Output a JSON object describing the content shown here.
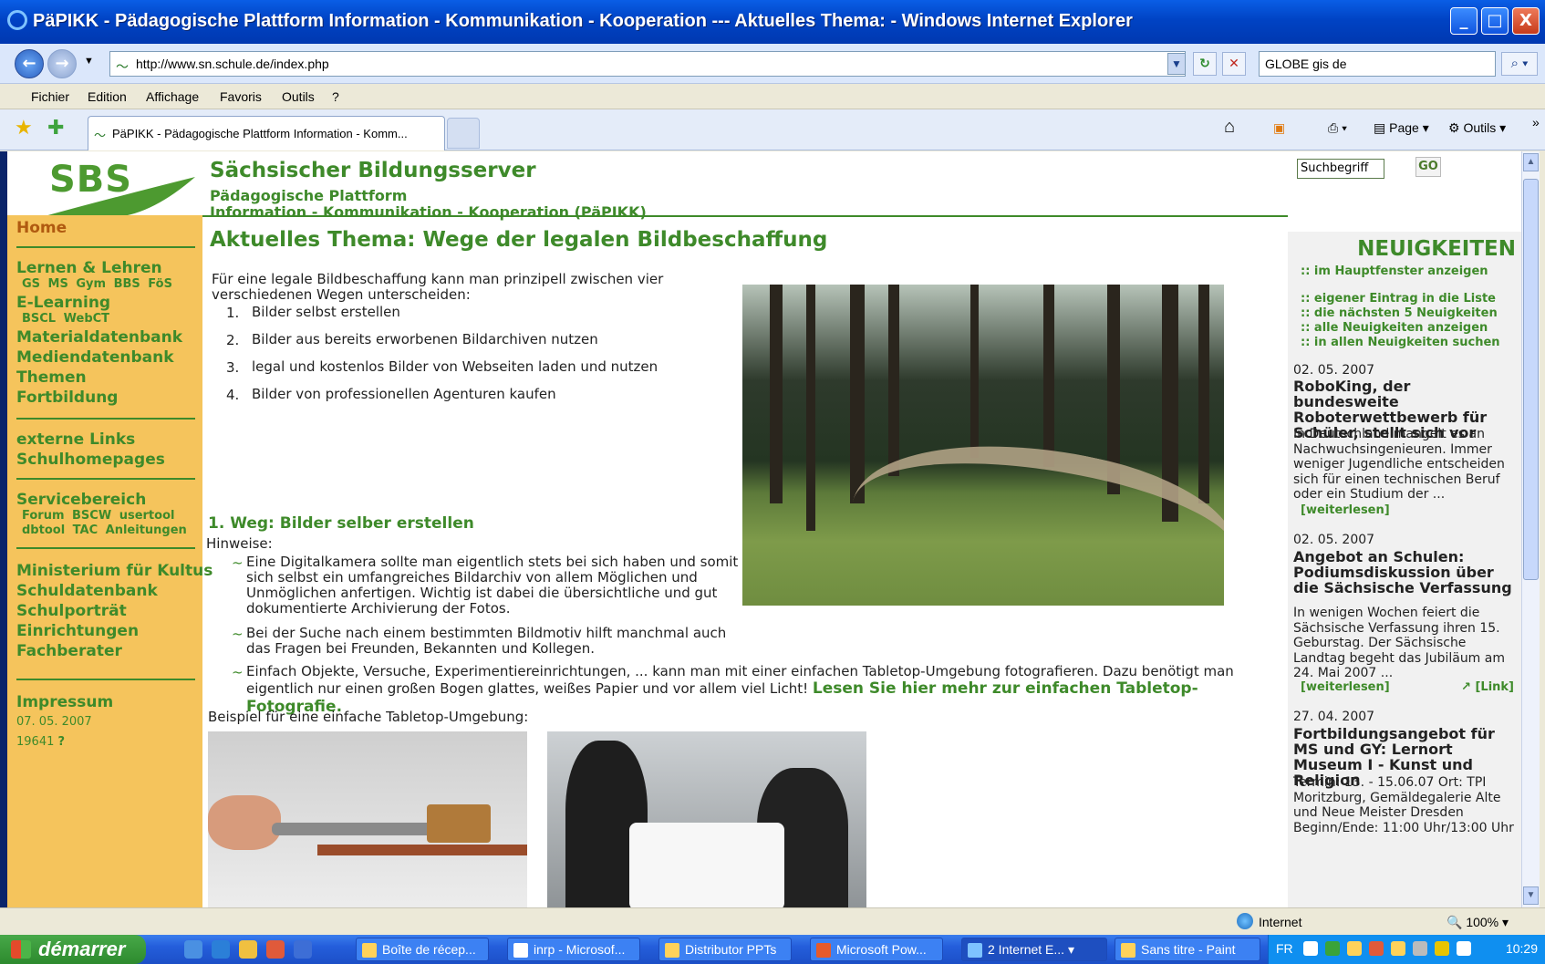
{
  "window": {
    "title": "PäPIKK - Pädagogische Plattform Information - Kommunikation - Kooperation --- Aktuelles Thema:  - Windows Internet Explorer",
    "minimize": "_",
    "maximize": "□",
    "close": "X"
  },
  "addressbar": {
    "url": "http://www.sn.schule.de/index.php",
    "search_value": "GLOBE gis de"
  },
  "menu": [
    "Fichier",
    "Edition",
    "Affichage",
    "Favoris",
    "Outils",
    "?"
  ],
  "tab": {
    "title": "PäPIKK - Pädagogische Plattform Information - Komm..."
  },
  "commandbar": {
    "page": "Page",
    "tools": "Outils"
  },
  "site": {
    "logo": "SBS",
    "title": "Sächsischer Bildungsserver",
    "subtitle1": "Pädagogische Plattform",
    "subtitle2": "Information - Kommunikation - Kooperation (PäPIKK)",
    "search_placeholder": "Suchbegriff",
    "go": "GO"
  },
  "leftnav": {
    "home": "Home",
    "lernen": "Lernen & Lehren",
    "lernen_sub": "GS  MS  Gym  BBS  FöS",
    "elearning": "E-Learning",
    "elearning_sub": "BSCL  WebCT",
    "materialdatenbank": "Materialdatenbank",
    "mediendatenbank": "Mediendatenbank",
    "themen": "Themen",
    "fortbildung": "Fortbildung",
    "externe": "externe Links",
    "schulhomepages": "Schulhomepages",
    "servicebereich": "Servicebereich",
    "service_sub1": "Forum  BSCW  usertool",
    "service_sub2": "dbtool  TAC  Anleitungen",
    "ministerium": "Ministerium für Kultus",
    "schuldatenbank": "Schuldatenbank",
    "schulportraet": "Schulporträt",
    "einrichtungen": "Einrichtungen",
    "fachberater": "Fachberater",
    "impressum": "Impressum",
    "date": "07. 05. 2007",
    "counter": "19641",
    "counter_help": "?"
  },
  "main": {
    "heading": "Aktuelles Thema: Wege der legalen Bildbeschaffung",
    "intro": "Für eine legale Bildbeschaffung kann man prinzipell zwischen vier verschiedenen Wegen unterscheiden:",
    "ways": [
      "Bilder selbst erstellen",
      "Bilder aus bereits erworbenen Bildarchiven nutzen",
      "legal und kostenlos Bilder von Webseiten laden und nutzen",
      "Bilder von professionellen Agenturen kaufen"
    ],
    "way_numbers": [
      "1.",
      "2.",
      "3.",
      "4."
    ],
    "section1": "1. Weg: Bilder selber erstellen",
    "hinweise": "Hinweise:",
    "tips": [
      "Eine Digitalkamera sollte man eigentlich stets bei sich haben und somit sich selbst ein umfangreiches Bildarchiv von allem Möglichen und Unmöglichen anfertigen. Wichtig ist dabei die übersichtliche und gut dokumentierte Archivierung der Fotos.",
      "Bei der Suche nach einem bestimmten Bildmotiv hilft manchmal auch das Fragen bei Freunden, Bekannten und Kollegen.",
      "Einfach Objekte, Versuche, Experimentiereinrichtungen, ... kann man mit einer einfachen Tabletop-Umgebung fotografieren. Dazu benötigt man eigentlich nur einen großen Bogen glattes, weißes Papier und vor allem viel Licht!"
    ],
    "tip_bullet": "~",
    "tabletop_link": "Lesen Sie hier mehr zur einfachen Tabletop-Fotografie.",
    "beispiel": "Beispiel für eine einfache Tabletop-Umgebung:"
  },
  "news": {
    "heading": "NEUIGKEITEN",
    "links": [
      ":: im Hauptfenster anzeigen",
      ":: eigener Eintrag in die Liste",
      ":: die nächsten 5 Neuigkeiten",
      ":: alle Neuigkeiten anzeigen",
      ":: in allen Neuigkeiten suchen"
    ],
    "items": [
      {
        "date": "02. 05. 2007",
        "title": "RoboKing, der bundesweite Roboterwettbewerb für Schüler, stellt sich vor",
        "body": "In Deutschland mangelt es an Nachwuchsingenieuren. Immer weniger Jugendliche entscheiden sich für einen technischen Beruf oder ein Studium der ...",
        "more": "[weiterlesen]"
      },
      {
        "date": "02. 05. 2007",
        "title": "Angebot an Schulen: Podiumsdiskussion über die Sächsische Verfassung",
        "body": "In wenigen Wochen feiert die Sächsische Verfassung ihren 15. Geburstag. Der Sächsische Landtag begeht das Jubiläum am 24. Mai 2007 ...",
        "more": "[weiterlesen]",
        "link": "[Link]"
      },
      {
        "date": "27. 04. 2007",
        "title": "Fortbildungsangebot für MS und GY: Lernort Museum I - Kunst und Religion",
        "body": "Termin: 13. - 15.06.07 Ort: TPI Moritzburg, Gemäldegalerie Alte und Neue Meister Dresden Beginn/Ende: 11:00 Uhr/13:00 Uhr"
      }
    ]
  },
  "statusbar": {
    "zone": "Internet",
    "zoom": "100%"
  },
  "taskbar": {
    "start": "démarrer",
    "tasks": [
      "Boîte de récep...",
      "inrp - Microsof...",
      "Distributor PPTs",
      "Microsoft Pow...",
      "2 Internet E...",
      "Sans titre - Paint"
    ],
    "lang": "FR",
    "clock": "10:29"
  }
}
